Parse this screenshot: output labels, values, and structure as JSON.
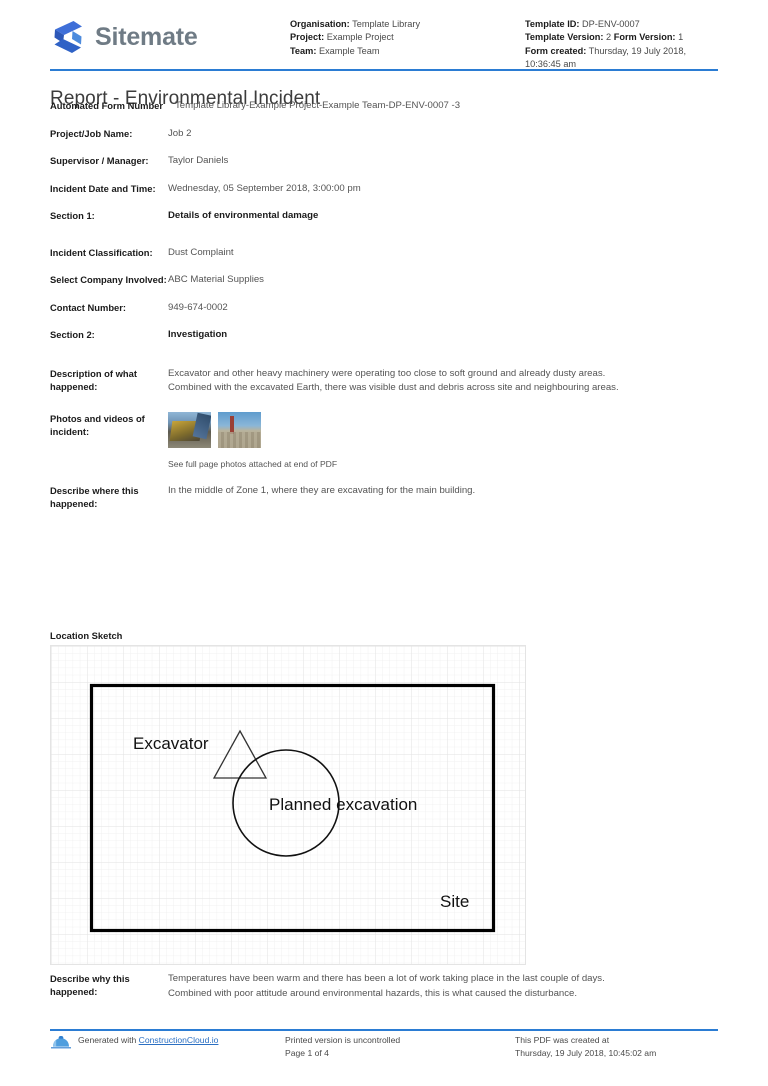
{
  "brand": {
    "name": "Sitemate",
    "logo_icon": "sitemate-logo-icon"
  },
  "header": {
    "left_meta": [
      {
        "label": "Organisation:",
        "value": "Template Library"
      },
      {
        "label": "Project:",
        "value": "Example Project"
      },
      {
        "label": "Team:",
        "value": "Example Team"
      }
    ],
    "right_meta": [
      {
        "label": "Template ID:",
        "value": "DP-ENV-0007"
      },
      {
        "label": "Template Version:",
        "value": "2",
        "label2": "Form Version:",
        "value2": "1"
      },
      {
        "label": "Form created:",
        "value": "Thursday, 19 July 2018, 10:36:45 am"
      }
    ]
  },
  "title": "Report - Environmental Incident",
  "fields": {
    "automated_form_number": {
      "label": "Automated Form Number",
      "value": "Template Library-Example Project-Example Team-DP-ENV-0007   -3"
    },
    "project_job_name": {
      "label": "Project/Job Name:",
      "value": "Job 2"
    },
    "supervisor_manager": {
      "label": "Supervisor / Manager:",
      "value": "Taylor Daniels"
    },
    "incident_date_time": {
      "label": "Incident Date and Time:",
      "value": "Wednesday, 05 September 2018, 3:00:00 pm"
    },
    "section_1": {
      "label": "Section 1:",
      "value": "Details of environmental damage"
    },
    "incident_classification": {
      "label": "Incident Classification:",
      "value": "Dust Complaint"
    },
    "select_company_involved": {
      "label": "Select Company Involved:",
      "value": "ABC Material Supplies"
    },
    "contact_number": {
      "label": "Contact Number:",
      "value": "949-674-0002"
    },
    "section_2": {
      "label": "Section 2:",
      "value": "Investigation"
    },
    "description_of_what_happened": {
      "label": "Description of what happened:",
      "line1": "Excavator and other heavy machinery were operating too close to soft ground and already dusty areas.",
      "line2": "Combined with the excavated Earth, there was visible dust and debris across site and neighbouring areas."
    },
    "photos_and_videos": {
      "label": "Photos and videos of incident:",
      "caption": "See full page photos attached at end of PDF",
      "thumbnails": [
        "excavator-photo-thumbnail",
        "site-ground-photo-thumbnail"
      ]
    },
    "describe_where": {
      "label": "Describe where this happened:",
      "value": "In the middle of Zone 1, where they are excavating for the main building."
    },
    "describe_why": {
      "label": "Describe why this happened:",
      "line1": "Temperatures have been warm and there has been a lot of work taking place in the last couple of days.",
      "line2": "Combined with poor attitude around environmental hazards, this is what caused the disturbance."
    }
  },
  "location_sketch": {
    "label": "Location Sketch",
    "annotations": {
      "excavator": "Excavator",
      "planned_excavation": "Planned excavation",
      "site": "Site"
    }
  },
  "footer": {
    "hardhat_icon": "hard-hat-icon",
    "generated_with_prefix": "Generated with ",
    "generated_with_link": "ConstructionCloud.io",
    "printed_notice": "Printed version is uncontrolled",
    "page_number": "Page 1 of 4",
    "pdf_created_label": "This PDF was created at",
    "pdf_created_value": "Thursday, 19 July 2018, 10:45:02 am"
  },
  "colors": {
    "accent_blue": "#2b7cd3",
    "link_blue": "#2b6fc2",
    "brand_grey": "#6f7b85"
  }
}
